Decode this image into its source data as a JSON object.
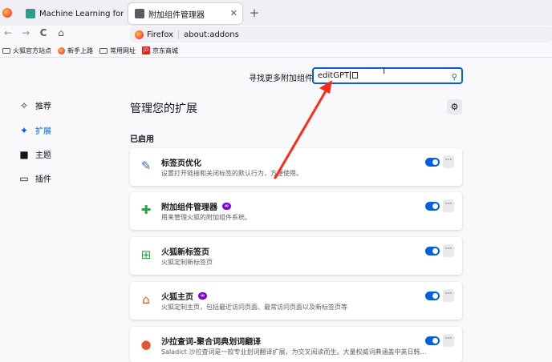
{
  "tabs": [
    {
      "title": "Machine Learning for Data A"
    },
    {
      "title": "附加组件管理器"
    }
  ],
  "new_tab": "+",
  "nav": {
    "back": "←",
    "forward": "→",
    "reload": "C",
    "home": "⌂",
    "identity": "Firefox",
    "url": "about:addons"
  },
  "bookmarks": [
    {
      "label": "火狐官方站点"
    },
    {
      "label": "新手上路"
    },
    {
      "label": "常用网址"
    },
    {
      "label": "京东商城"
    }
  ],
  "search": {
    "label": "寻找更多附加组件",
    "value": "editGPT"
  },
  "categories": [
    {
      "label": "推荐",
      "icon": "sparkle-icon"
    },
    {
      "label": "扩展",
      "icon": "puzzle-icon"
    },
    {
      "label": "主题",
      "icon": "brush-icon"
    },
    {
      "label": "插件",
      "icon": "plugin-icon"
    }
  ],
  "main": {
    "title": "管理您的扩展",
    "enabled_heading": "已启用"
  },
  "extensions": [
    {
      "name": "标签页优化",
      "desc": "设置打开链接和关闭标签的默认行为，方便使用。",
      "badge": false
    },
    {
      "name": "附加组件管理器",
      "desc": "用来管理火狐的附加组件系统。",
      "badge": true
    },
    {
      "name": "火狐新标签页",
      "desc": "火狐定制新标签页",
      "badge": false
    },
    {
      "name": "火狐主页",
      "desc": "火狐定制主页，包括最近访问页面、最常访问页面以及新标签页等",
      "badge": true
    },
    {
      "name": "沙拉查词-聚合词典划词翻译",
      "desc": "Saladict 沙拉查词是一款专业划词翻译扩展，为交叉阅读而生。大量权威词典涵盖中英日韩…",
      "badge": false
    }
  ],
  "colors": {
    "accent": "#0061e0",
    "badge": "#8000d7",
    "arrow": "#ff2a1a"
  }
}
